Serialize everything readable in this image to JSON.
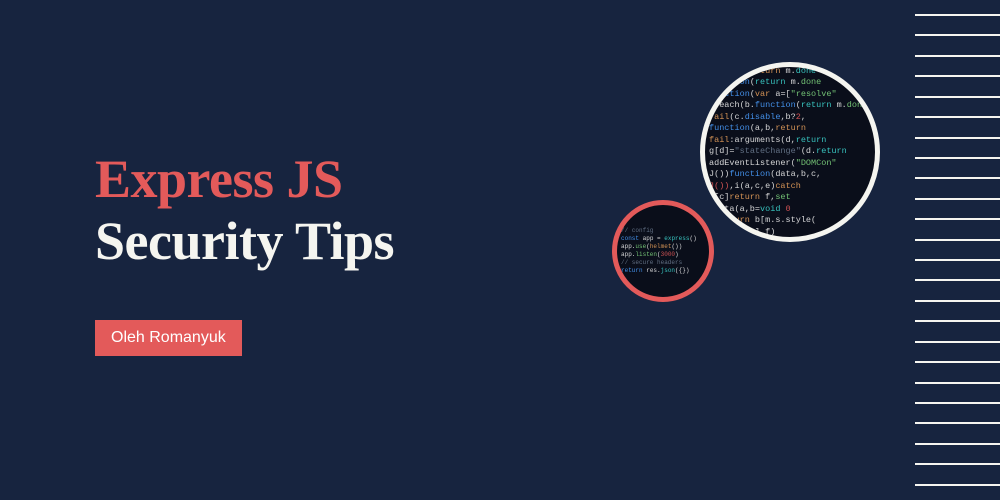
{
  "title": {
    "line1": "Express JS",
    "line2": "Security Tips"
  },
  "author": "Oleh Romanyuk",
  "colors": {
    "background": "#17243f",
    "accent": "#e35a5a",
    "text_light": "#f5f5f0"
  },
  "decorative_circles": [
    {
      "size": "large",
      "border_color": "#f5f5f0",
      "content": "code-screenshot"
    },
    {
      "size": "small",
      "border_color": "#e35a5a",
      "content": "code-screenshot"
    }
  ],
  "stripe_count": 24
}
